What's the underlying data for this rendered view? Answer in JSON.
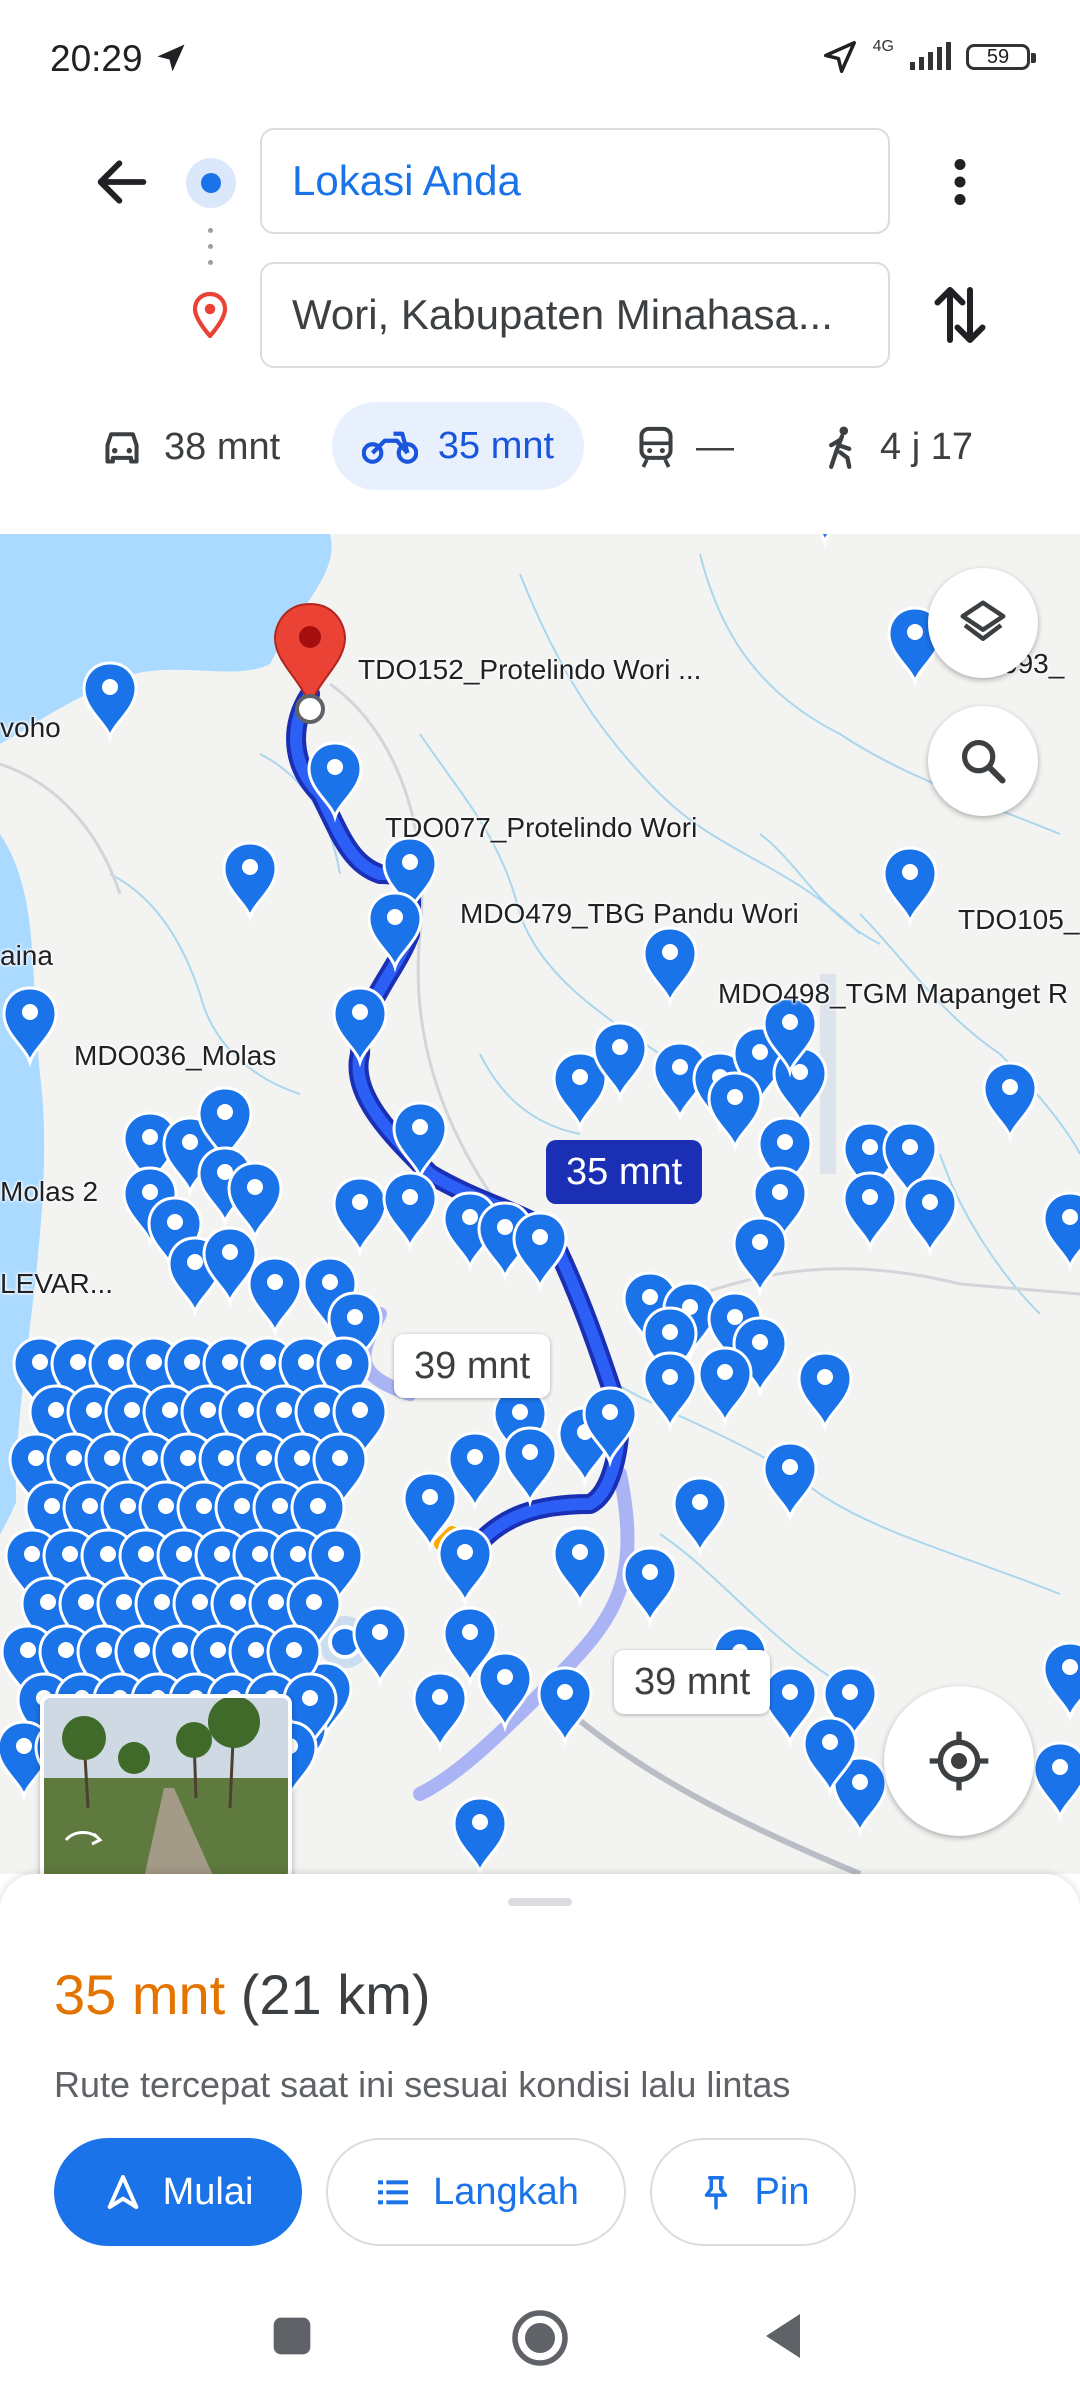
{
  "status_bar": {
    "time": "20:29",
    "network": "4G",
    "battery": "59"
  },
  "directions": {
    "origin": "Lokasi Anda",
    "destination": "Wori, Kabupaten Minahasa...",
    "modes": [
      {
        "name": "car",
        "label": "38 mnt",
        "icon": "car-icon"
      },
      {
        "name": "motorcycle",
        "label": "35 mnt",
        "icon": "motorcycle-icon",
        "selected": true
      },
      {
        "name": "transit",
        "label": "—",
        "icon": "train-icon"
      },
      {
        "name": "walk",
        "label": "4 j 17",
        "icon": "walk-icon"
      }
    ]
  },
  "map": {
    "labels": {
      "tdo152": "TDO152_Protelindo Wori ...",
      "tdo077": "TDO077_Protelindo Wori",
      "mdo479": "MDO479_TBG Pandu Wori",
      "mdo498": "MDO498_TGM Mapanget R",
      "mdo036": "MDO036_Molas",
      "tdo105": "TDO105_",
      "d093": "093_",
      "voho": "voho",
      "aina": "aina",
      "molas2": "Molas 2",
      "levar": "LEVAR..."
    },
    "route_time": "35 mnt",
    "alt_time_1": "39 mnt",
    "alt_time_2": "39 mnt",
    "colors": {
      "water": "#aadaff",
      "route": "#1a2fb3",
      "alt_route": "#aab4f5",
      "pin": "#1a73e8",
      "dest_pin": "#ea4335"
    }
  },
  "sheet": {
    "time": "35 mnt",
    "distance": "(21 km)",
    "description": "Rute tercepat saat ini sesuai kondisi lalu lintas",
    "start_label": "Mulai",
    "steps_label": "Langkah",
    "pin_label": "Pin"
  }
}
